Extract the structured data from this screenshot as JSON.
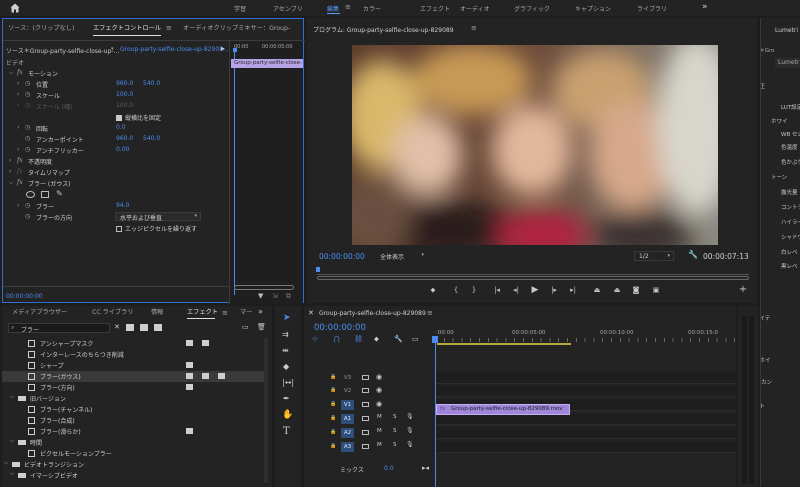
{
  "topbar": {
    "home_icon": "home-icon",
    "tabs": [
      "学習",
      "アセンブリ",
      "編集",
      "カラー",
      "エフェクト",
      "オーディオ",
      "グラフィック",
      "キャプション",
      "ライブラリ"
    ],
    "active": 2,
    "more": "»"
  },
  "effect_controls": {
    "tabs": [
      "ソース：(クリップなし)",
      "エフェクトコントロール",
      "オーディオクリップミキサー：Group-"
    ],
    "source_label": "ソース＊Group-party-selfie-close-up-...",
    "clip_label": "Group-party-selfie-close-up-82908...",
    "timecodes": [
      "00:00",
      "00:00:05:00"
    ],
    "clip_bar": "Group-party-selfie-close-",
    "video_label": "ビデオ",
    "motion": "モーション",
    "position": "位置",
    "pos_x": "960.0",
    "pos_y": "540.0",
    "scale": "スケール",
    "scale_v": "100.0",
    "scale_w": "スケール (幅)",
    "scale_w_v": "100.0",
    "uniform": "縦横比を固定",
    "rotation": "回転",
    "rotation_v": "0.0",
    "anchor": "アンカーポイント",
    "anchor_x": "960.0",
    "anchor_y": "540.0",
    "flicker": "アンチフリッカー",
    "flicker_v": "0.00",
    "opacity": "不透明度",
    "timeremap": "タイムリマップ",
    "blur_fx": "ブラー (ガウス)",
    "blur": "ブラー",
    "blur_v": "94.0",
    "blur_dir": "ブラーの方向",
    "blur_dir_v": "水平および垂直",
    "repeat_edge": "エッジピクセルを繰り返す",
    "bottom_time": "00:00:00:00"
  },
  "program": {
    "title": "プログラム: Group-party-selfie-close-up-829089",
    "timecode": "00:00:00:00",
    "fit": "全体表示",
    "quality": "1/2",
    "duration": "00:00:07:13"
  },
  "lumetri": {
    "title": "Lumetri カ",
    "source": "ソース＊Gro",
    "master": "Lumetr",
    "items": [
      "基本補正",
      "LUT設定",
      "ホワイ",
      "WB セレ",
      "色温度",
      "色かぶり",
      "トーン",
      "露光量",
      "コントラ",
      "ハイライ",
      "シャドウ",
      "白レベ",
      "黒レベ",
      "彩度",
      "クリエイテ",
      "カーブ",
      "カラーホイ",
      "HSL セカン",
      "ビネット"
    ]
  },
  "effects": {
    "tabs": [
      "メディアブラウザー",
      "CC ライブラリ",
      "情報",
      "エフェクト",
      "マー"
    ],
    "search": "ブラー",
    "items": [
      {
        "label": "アンシャープマスク",
        "level": 2,
        "type": "fx",
        "badges": 2
      },
      {
        "label": "インターレースのちらつき削減",
        "level": 2,
        "type": "fx",
        "badges": 0
      },
      {
        "label": "シャープ",
        "level": 2,
        "type": "fx",
        "badges": 1
      },
      {
        "label": "ブラー(ガウス)",
        "level": 2,
        "type": "fx",
        "badges": 3,
        "selected": true
      },
      {
        "label": "ブラー(方向)",
        "level": 2,
        "type": "fx",
        "badges": 1
      },
      {
        "label": "旧バージョン",
        "level": 1,
        "type": "folder",
        "badges": 0
      },
      {
        "label": "ブラー(チャンネル)",
        "level": 2,
        "type": "fx",
        "badges": 0
      },
      {
        "label": "ブラー(合成)",
        "level": 2,
        "type": "fx",
        "badges": 0
      },
      {
        "label": "ブラー(滑らか)",
        "level": 2,
        "type": "fx",
        "badges": 1
      },
      {
        "label": "時間",
        "level": 1,
        "type": "folder",
        "badges": 0
      },
      {
        "label": "ピクセルモーションブラー",
        "level": 2,
        "type": "fx",
        "badges": 0
      },
      {
        "label": "ビデオトランジション",
        "level": 0,
        "type": "folder",
        "badges": 0
      },
      {
        "label": "イマーシブビデオ",
        "level": 1,
        "type": "folder",
        "badges": 0
      }
    ]
  },
  "timeline": {
    "title": "Group-party-selfie-close-up-829089",
    "timecode": "00:00:00:00",
    "ruler": [
      ":00:00",
      "00:00:05:00",
      "00:00:10:00",
      "00:00:15:0"
    ],
    "tracks": [
      {
        "name": "V3",
        "kind": "v"
      },
      {
        "name": "V2",
        "kind": "v"
      },
      {
        "name": "V1",
        "kind": "v",
        "active": true
      },
      {
        "name": "A1",
        "kind": "a",
        "active": true
      },
      {
        "name": "A2",
        "kind": "a",
        "active": true
      },
      {
        "name": "A3",
        "kind": "a",
        "active": true
      }
    ],
    "mix": "ミックス",
    "mix_v": "0.0",
    "clip": "Group-party-selfie-close-up-829089.mov",
    "m": "M",
    "s": "S"
  }
}
